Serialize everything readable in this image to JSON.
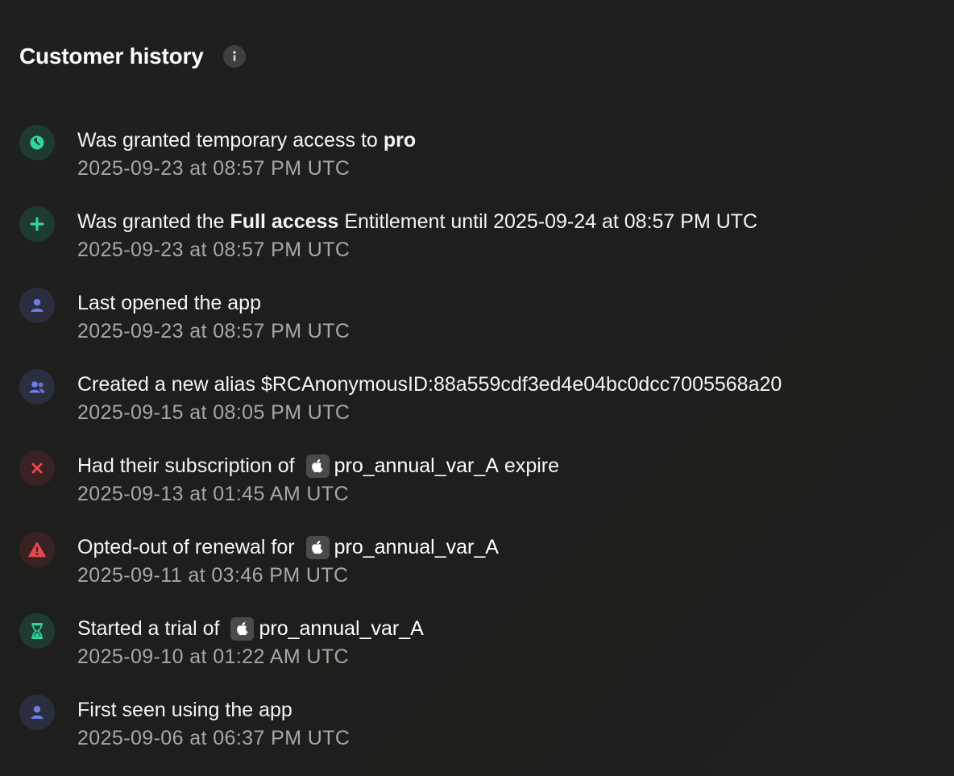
{
  "header": {
    "title": "Customer history"
  },
  "colors": {
    "green": "#2fd59a",
    "blue": "#6d7fe6",
    "red": "#e5484d",
    "green_bg": "#1f3a30",
    "blue_bg": "#2a2e3e",
    "red_bg": "#3a2224"
  },
  "events": [
    {
      "icon": "timer-icon",
      "pre": "Was granted temporary access to",
      "strong": "pro",
      "time": "2025-09-23 at 08:57 PM UTC"
    },
    {
      "icon": "plus-icon",
      "pre": "Was granted the",
      "strong": "Full access",
      "post": "Entitlement until 2025-09-24 at 08:57 PM UTC",
      "time": "2025-09-23 at 08:57 PM UTC"
    },
    {
      "icon": "user-icon",
      "pre": "Last opened the app",
      "time": "2025-09-23 at 08:57 PM UTC"
    },
    {
      "icon": "users-icon",
      "pre": "Created a new alias",
      "value": "$RCAnonymousID:88a559cdf3ed4e04bc0dcc7005568a20",
      "time": "2025-09-15 at 08:05 PM UTC"
    },
    {
      "icon": "x-icon",
      "pre": "Had their subscription of",
      "product": "pro_annual_var_A",
      "post": "expire",
      "time": "2025-09-13 at 01:45 AM UTC"
    },
    {
      "icon": "warning-icon",
      "pre": "Opted-out of renewal for",
      "product": "pro_annual_var_A",
      "time": "2025-09-11 at 03:46 PM UTC"
    },
    {
      "icon": "hourglass-icon",
      "pre": "Started a trial of",
      "product": "pro_annual_var_A",
      "time": "2025-09-10 at 01:22 AM UTC"
    },
    {
      "icon": "user-icon",
      "pre": "First seen using the app",
      "time": "2025-09-06 at 06:37 PM UTC"
    }
  ]
}
